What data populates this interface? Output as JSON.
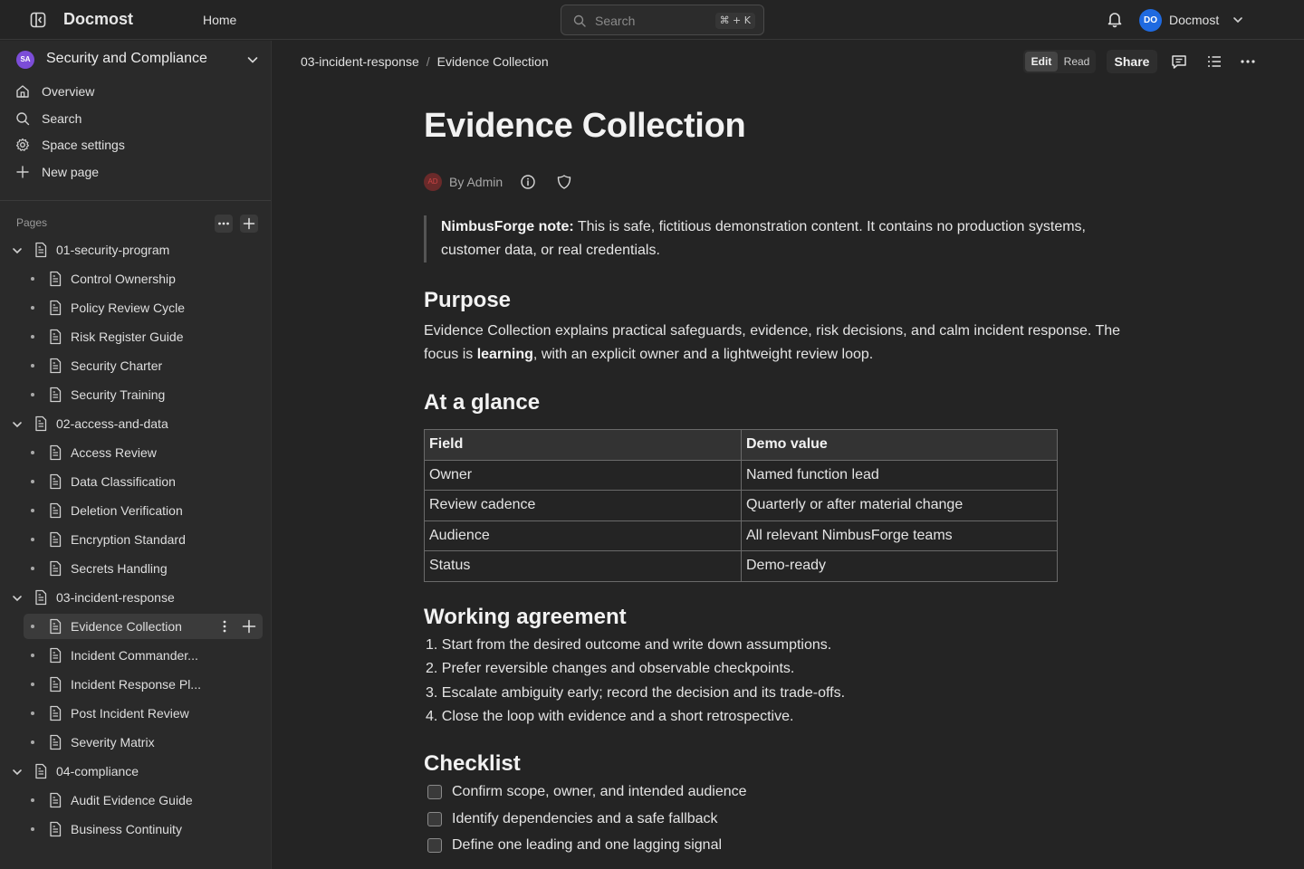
{
  "topbar": {
    "brand": "Docmost",
    "home": "Home",
    "search_placeholder": "Search",
    "search_shortcut": "⌘ + K",
    "user_initials": "DO",
    "user_name": "Docmost"
  },
  "sidebar": {
    "space_initials": "SA",
    "space_name": "Security and Compliance",
    "nav": [
      {
        "label": "Overview",
        "icon": "home-icon"
      },
      {
        "label": "Search",
        "icon": "search-icon"
      },
      {
        "label": "Space settings",
        "icon": "gear-icon"
      },
      {
        "label": "New page",
        "icon": "plus-icon"
      }
    ],
    "pages_label": "Pages",
    "tree": [
      {
        "label": "01-security-program",
        "type": "folder"
      },
      {
        "label": "Control Ownership",
        "type": "child"
      },
      {
        "label": "Policy Review Cycle",
        "type": "child"
      },
      {
        "label": "Risk Register Guide",
        "type": "child"
      },
      {
        "label": "Security Charter",
        "type": "child"
      },
      {
        "label": "Security Training",
        "type": "child"
      },
      {
        "label": "02-access-and-data",
        "type": "folder"
      },
      {
        "label": "Access Review",
        "type": "child"
      },
      {
        "label": "Data Classification",
        "type": "child"
      },
      {
        "label": "Deletion Verification",
        "type": "child"
      },
      {
        "label": "Encryption Standard",
        "type": "child"
      },
      {
        "label": "Secrets Handling",
        "type": "child"
      },
      {
        "label": "03-incident-response",
        "type": "folder"
      },
      {
        "label": "Evidence Collection",
        "type": "child",
        "active": true
      },
      {
        "label": "Incident Commander...",
        "type": "child"
      },
      {
        "label": "Incident Response Pl...",
        "type": "child"
      },
      {
        "label": "Post Incident Review",
        "type": "child"
      },
      {
        "label": "Severity Matrix",
        "type": "child"
      },
      {
        "label": "04-compliance",
        "type": "folder"
      },
      {
        "label": "Audit Evidence Guide",
        "type": "child"
      },
      {
        "label": "Business Continuity",
        "type": "child"
      }
    ]
  },
  "header": {
    "breadcrumb": [
      "03-incident-response",
      "Evidence Collection"
    ],
    "breadcrumb_sep": "/",
    "mode_edit": "Edit",
    "mode_read": "Read",
    "share": "Share"
  },
  "doc": {
    "title": "Evidence Collection",
    "author_initials": "AD",
    "byline": "By Admin",
    "note_label": "NimbusForge note:",
    "note_text": " This is safe, fictitious demonstration content. It contains no production systems, customer data, or real credentials.",
    "purpose_heading": "Purpose",
    "purpose_text_1": "Evidence Collection explains practical safeguards, evidence, risk decisions, and calm incident response. The focus is ",
    "purpose_bold": "learning",
    "purpose_text_2": ", with an explicit owner and a lightweight review loop.",
    "glance_heading": "At a glance",
    "table": {
      "headers": [
        "Field",
        "Demo value"
      ],
      "rows": [
        [
          "Owner",
          "Named function lead"
        ],
        [
          "Review cadence",
          "Quarterly or after material change"
        ],
        [
          "Audience",
          "All relevant NimbusForge teams"
        ],
        [
          "Status",
          "Demo-ready"
        ]
      ]
    },
    "agreement_heading": "Working agreement",
    "agreement": [
      "1. Start from the desired outcome and write down assumptions.",
      "2. Prefer reversible changes and observable checkpoints.",
      "3. Escalate ambiguity early; record the decision and its trade-offs.",
      "4. Close the loop with evidence and a short retrospective."
    ],
    "checklist_heading": "Checklist",
    "checklist": [
      "Confirm scope, owner, and intended audience",
      "Identify dependencies and a safe fallback",
      "Define one leading and one lagging signal"
    ]
  }
}
